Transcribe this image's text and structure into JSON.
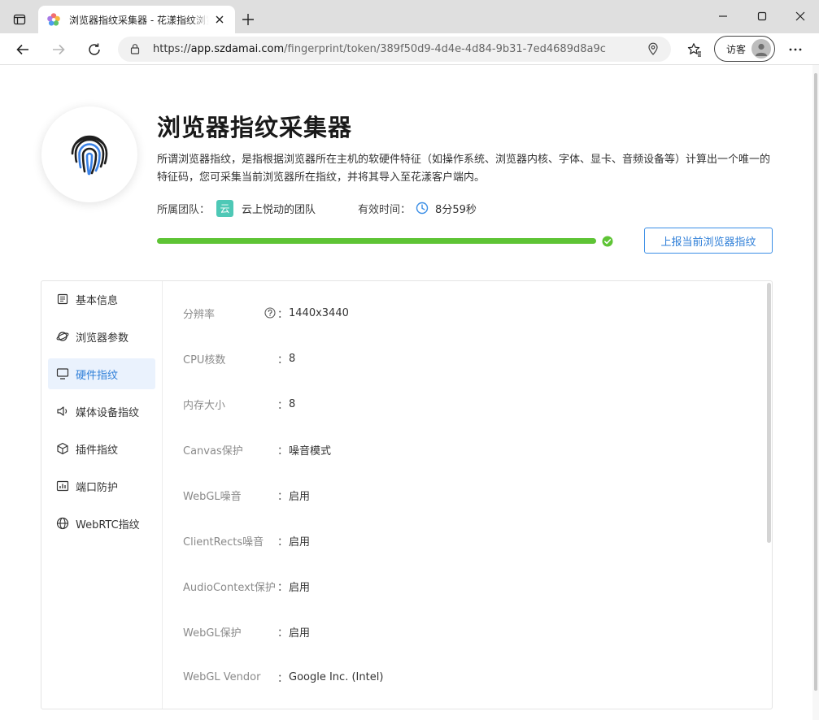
{
  "browser": {
    "tab_title": "浏览器指纹采集器 - 花漾指纹浏览器",
    "url_scheme": "https://",
    "url_host": "app.szdamai.com",
    "url_path": "/fingerprint/token/389f50d9-4d4e-4d84-9b31-7ed4689d8a9c",
    "guest_label": "访客"
  },
  "header": {
    "title": "浏览器指纹采集器",
    "description": "所谓浏览器指纹，是指根据浏览器所在主机的软硬件特征（如操作系统、浏览器内核、字体、显卡、音频设备等）计算出一个唯一的特征码，您可采集当前浏览器所在指纹，并将其导入至花漾客户端内。",
    "team_label": "所属团队：",
    "team_badge": "云",
    "team_name": "云上悦动的团队",
    "valid_label": "有效时间：",
    "valid_time": "8分59秒",
    "progress_percent": 100,
    "report_button": "上报当前浏览器指纹"
  },
  "nav": {
    "items": [
      {
        "label": "基本信息",
        "icon": "list-icon",
        "active": false
      },
      {
        "label": "浏览器参数",
        "icon": "planet-icon",
        "active": false
      },
      {
        "label": "硬件指纹",
        "icon": "monitor-icon",
        "active": true
      },
      {
        "label": "媒体设备指纹",
        "icon": "speaker-icon",
        "active": false
      },
      {
        "label": "插件指纹",
        "icon": "cube-icon",
        "active": false
      },
      {
        "label": "端口防护",
        "icon": "chart-icon",
        "active": false
      },
      {
        "label": "WebRTC指纹",
        "icon": "globe-icon",
        "active": false
      }
    ]
  },
  "hardware": {
    "rows": [
      {
        "label": "分辨率",
        "value": "1440x3440",
        "help": true
      },
      {
        "label": "CPU核数",
        "value": "8",
        "help": false
      },
      {
        "label": "内存大小",
        "value": "8",
        "help": false
      },
      {
        "label": "Canvas保护",
        "value": "噪音模式",
        "help": false
      },
      {
        "label": "WebGL噪音",
        "value": "启用",
        "help": false
      },
      {
        "label": "ClientRects噪音",
        "value": "启用",
        "help": false
      },
      {
        "label": "AudioContext保护",
        "value": "启用",
        "help": false
      },
      {
        "label": "WebGL保护",
        "value": "启用",
        "help": false
      },
      {
        "label": "WebGL Vendor",
        "value": "Google Inc. (Intel)",
        "help": false
      }
    ],
    "colon": "："
  }
}
